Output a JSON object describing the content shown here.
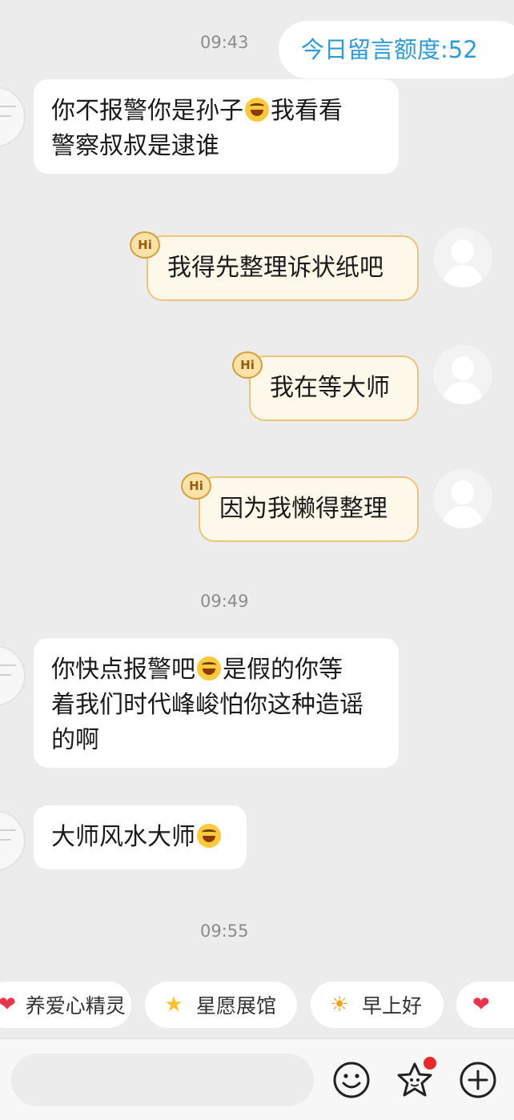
{
  "quota": {
    "label": "今日留言额度:52"
  },
  "messages": [
    {
      "time": "09:43"
    },
    {
      "line1": "你不报警你是孙子",
      "line1b": "我看看",
      "line2": "警察叔叔是逮谁"
    },
    {
      "text": "我得先整理诉状纸吧",
      "badge": "Hi"
    },
    {
      "text": "我在等大师",
      "badge": "Hi"
    },
    {
      "text": "因为我懒得整理",
      "badge": "Hi"
    },
    {
      "time": "09:49"
    },
    {
      "line1": "你快点报警吧",
      "line1b": "是假的你等",
      "line2": "着我们时代峰峻怕你这种造谣",
      "line3": "的啊"
    },
    {
      "line1": "大师风水大师"
    },
    {
      "time": "09:55"
    }
  ],
  "chips": [
    {
      "label": "养爱心精灵",
      "icon": "heart-icon"
    },
    {
      "label": "星愿展馆",
      "icon": "star-face-icon"
    },
    {
      "label": "早上好",
      "icon": "sun-face-icon"
    },
    {
      "label": "",
      "icon": "heart-icon"
    }
  ],
  "colors": {
    "background": "#ececec",
    "quota_text": "#2f9bd6",
    "outgoing_bubble": "#fdf8ea",
    "outgoing_border": "#ecc676",
    "badge_red": "#e8292b"
  }
}
